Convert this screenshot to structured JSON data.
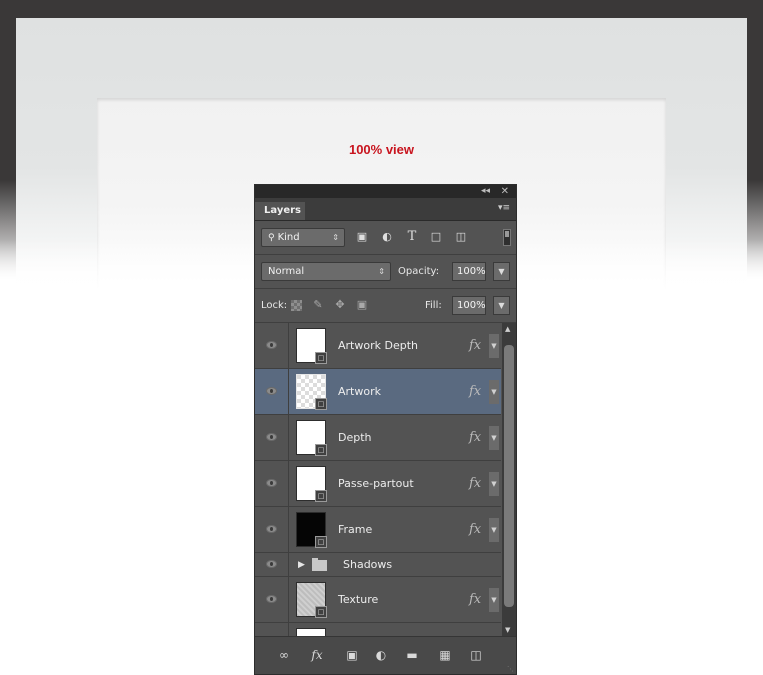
{
  "canvas": {
    "zoom_label": "100% view",
    "zoom_label_color": "#c8141e"
  },
  "panel": {
    "tab_label": "Layers",
    "filter": {
      "kind_label": "Kind",
      "icons": [
        "pixel-filter-icon",
        "adjustment-filter-icon",
        "type-filter-icon",
        "shape-filter-icon",
        "smart-object-filter-icon"
      ]
    },
    "blend_mode": "Normal",
    "opacity_label": "Opacity:",
    "opacity_value": "100%",
    "lock_label": "Lock:",
    "fill_label": "Fill:",
    "fill_value": "100%",
    "layers": [
      {
        "name": "Artwork Depth",
        "thumb": "white",
        "fx": "fx",
        "selected": false
      },
      {
        "name": "Artwork",
        "thumb": "transparent",
        "fx": "fx",
        "selected": true
      },
      {
        "name": "Depth",
        "thumb": "white",
        "fx": "fx",
        "selected": false
      },
      {
        "name": "Passe-partout",
        "thumb": "white",
        "fx": "fx",
        "selected": false
      },
      {
        "name": "Frame",
        "thumb": "black",
        "fx": "fx",
        "selected": false
      },
      {
        "name": "Shadows",
        "type": "group",
        "collapsed": true
      },
      {
        "name": "Texture",
        "thumb": "texture",
        "fx": "fx",
        "selected": false
      }
    ],
    "footer_icons": [
      "link-icon",
      "fx-icon",
      "mask-icon",
      "adjustment-icon",
      "folder-icon",
      "new-layer-icon",
      "trash-icon"
    ],
    "selected_color": "#5a6a80"
  }
}
